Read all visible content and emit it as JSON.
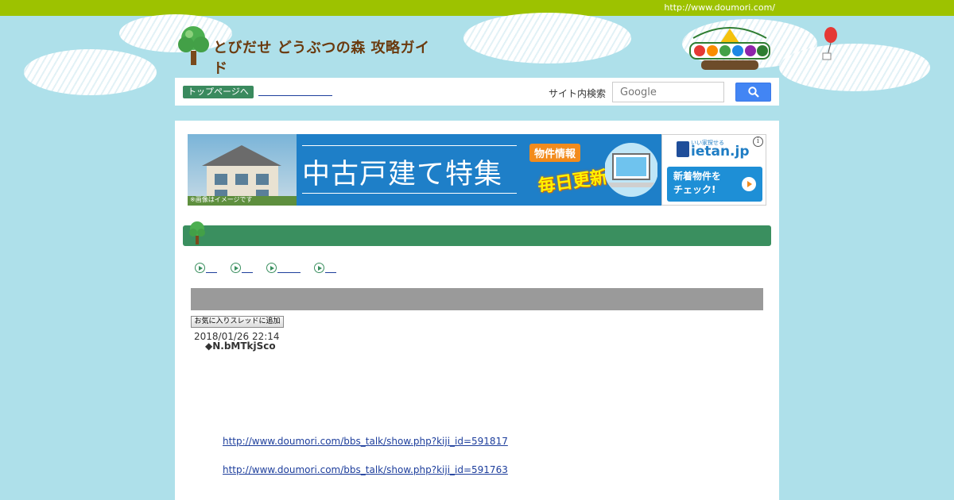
{
  "top_bar": {
    "url": "http://www.doumori.com/"
  },
  "header": {
    "site_title": "とびだせ どうぶつの森 攻略ガイド"
  },
  "navbar": {
    "home_label": "トップページへ",
    "search_label": "サイト内検索",
    "search_placeholder": "Google"
  },
  "ad": {
    "headline": "中古戸建て特集",
    "tag": "物件情報",
    "daily": "毎日更新",
    "house_caption": "※画像はイメージです",
    "brand_small": "いい家探せる",
    "brand": "ietan.jp",
    "cta_line1": "新着物件を",
    "cta_line2": "チェック!",
    "info_glyph": "i"
  },
  "post": {
    "favorite_button": "お気に入りスレッドに追加",
    "date": "2018/01/26 22:14",
    "author": "◆N.bMTkjSco",
    "links": [
      "http://www.doumori.com/bbs_talk/show.php?kiji_id=591817",
      "http://www.doumori.com/bbs_talk/show.php?kiji_id=591763"
    ]
  },
  "colors": {
    "top_bar": "#9dc200",
    "background": "#aee0ea",
    "accent_green": "#3a8f5f",
    "link": "#1d3e9c",
    "google_blue": "#4285f4"
  }
}
